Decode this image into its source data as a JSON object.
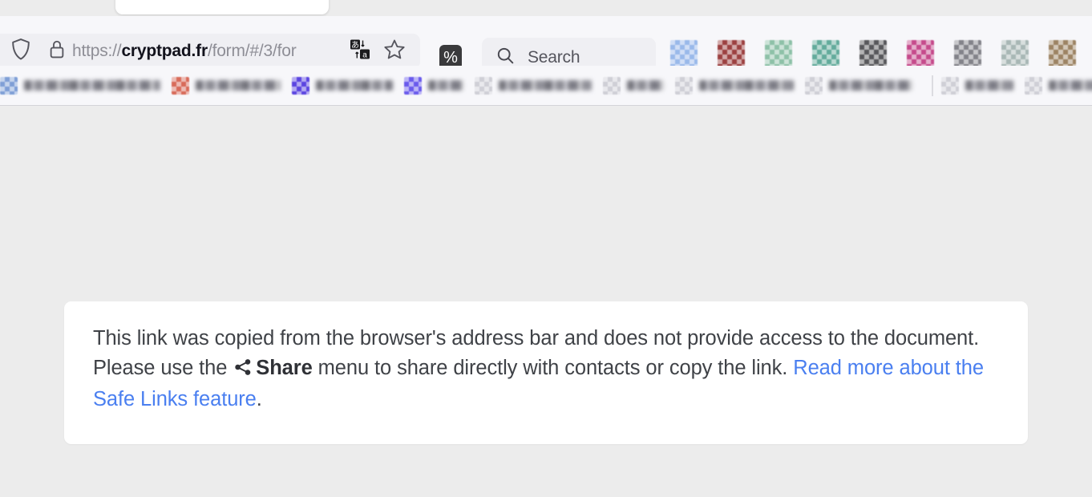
{
  "browser": {
    "tab": {
      "name": "active-tab"
    },
    "urlbar": {
      "scheme": "https://",
      "host": "cryptpad.fr",
      "path": "/form/#/3/for",
      "full_value": "https://cryptpad.fr/form/#/3/for",
      "shield_icon": "shield-icon",
      "lock_icon": "lock-icon",
      "translate_icon": "translate-icon",
      "star_icon": "bookmark-star-icon"
    },
    "percent_button": {
      "label": "%",
      "icon": "percent-icon"
    },
    "search": {
      "placeholder": "Search",
      "value": "",
      "icon": "search-icon"
    },
    "extensions": [
      {
        "name": "extension-icon-1",
        "color": "#9ab9ea"
      },
      {
        "name": "extension-icon-2",
        "color": "#9c4141"
      },
      {
        "name": "extension-icon-3",
        "color": "#8ec1a8"
      },
      {
        "name": "extension-icon-4",
        "color": "#63ab9c"
      },
      {
        "name": "extension-icon-5",
        "color": "#58585c"
      },
      {
        "name": "extension-icon-6",
        "color": "#c54b8c"
      },
      {
        "name": "extension-icon-7",
        "color": "#83838a"
      },
      {
        "name": "extension-icon-8",
        "color": "#a8b7b5"
      },
      {
        "name": "extension-icon-9",
        "color": "#9d8464"
      }
    ],
    "bookmarks": [
      {
        "name": "bookmark-1",
        "label": "",
        "label_width": 170,
        "icon_color": "#7f9fd6"
      },
      {
        "name": "bookmark-2",
        "label": "",
        "label_width": 106,
        "icon_color": "#d86b5a"
      },
      {
        "name": "bookmark-3",
        "label": "",
        "label_width": 96,
        "icon_color": "#5b45e0"
      },
      {
        "name": "bookmark-4",
        "label": "",
        "label_width": 44,
        "icon_color": "#6a5bec"
      },
      {
        "name": "bookmark-5",
        "label": "",
        "label_width": 116,
        "icon_color": "#cfcfd6"
      },
      {
        "name": "bookmark-6",
        "label": "",
        "label_width": 46,
        "icon_color": "#cfcfd6"
      },
      {
        "name": "bookmark-7",
        "label": "",
        "label_width": 118,
        "icon_color": "#cfcfd6"
      },
      {
        "name": "bookmark-8",
        "label": "",
        "label_width": 104,
        "icon_color": "#cfcfd6"
      },
      {
        "name": "bookmark-separator-1",
        "separator": true
      },
      {
        "name": "bookmark-9",
        "label": "",
        "label_width": 60,
        "icon_color": "#cfcfd6"
      },
      {
        "name": "bookmark-10",
        "label": "",
        "label_width": 178,
        "icon_color": "#cfcfd6"
      },
      {
        "name": "bookmark-separator-2",
        "separator": true
      }
    ]
  },
  "notice": {
    "text_part_1": "This link was copied from the browser's address bar and does not provide access to the document. Please use the ",
    "share_icon": "share-icon",
    "share_label": "Share",
    "text_part_2": " menu to share directly with contacts or copy the link. ",
    "link_label": "Read more about the Safe Links feature",
    "link_suffix": ".",
    "colors": {
      "link": "#4a7ff0",
      "text": "#3f4247",
      "card_background": "#ffffff",
      "page_background": "#ececec"
    }
  }
}
